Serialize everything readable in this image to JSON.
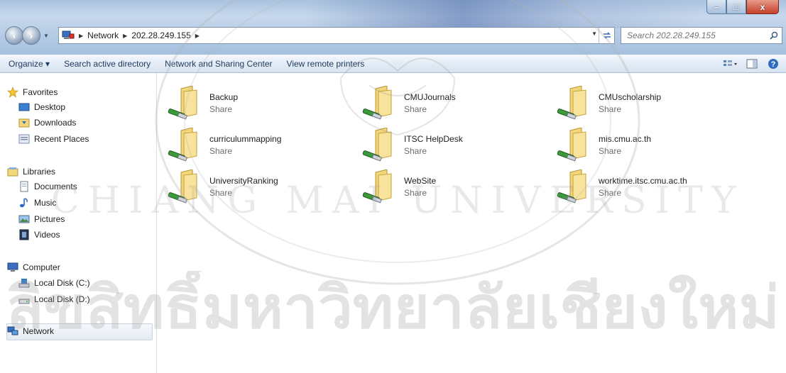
{
  "window": {
    "min_glyph": "–",
    "max_glyph": "□",
    "close_glyph": "x"
  },
  "address": {
    "crumbs": [
      "Network",
      "202.28.249.155"
    ]
  },
  "search": {
    "placeholder": "Search 202.28.249.155"
  },
  "toolbar": {
    "organize_label": "Organize ▾",
    "search_ad_label": "Search active directory",
    "sharing_center_label": "Network and Sharing Center",
    "printers_label": "View remote printers"
  },
  "nav": {
    "favorites": "Favorites",
    "desktop": "Desktop",
    "downloads": "Downloads",
    "recent": "Recent Places",
    "libraries": "Libraries",
    "documents": "Documents",
    "music": "Music",
    "pictures": "Pictures",
    "videos": "Videos",
    "computer": "Computer",
    "disk_c": "Local Disk (C:)",
    "disk_d": "Local Disk (D:)",
    "network": "Network"
  },
  "shares": [
    {
      "name": "Backup",
      "type": "Share"
    },
    {
      "name": "CMUJournals",
      "type": "Share"
    },
    {
      "name": "CMUscholarship",
      "type": "Share"
    },
    {
      "name": "curriculummapping",
      "type": "Share"
    },
    {
      "name": "ITSC HelpDesk",
      "type": "Share"
    },
    {
      "name": "mis.cmu.ac.th",
      "type": "Share"
    },
    {
      "name": "UniversityRanking",
      "type": "Share"
    },
    {
      "name": "WebSite",
      "type": "Share"
    },
    {
      "name": "worktime.itsc.cmu.ac.th",
      "type": "Share"
    }
  ],
  "watermark": {
    "thai_text": "ลิขสิทธิ์มหาวิทยาลัยเชียงใหม่",
    "latin_text": "CHIANG MAI UNIVERSITY"
  },
  "colors": {
    "toolbar_text": "#1e395b",
    "folder_yellow": "#f2d77a",
    "share_green": "#3c9a3a",
    "watermark": "#9a9a9a"
  }
}
